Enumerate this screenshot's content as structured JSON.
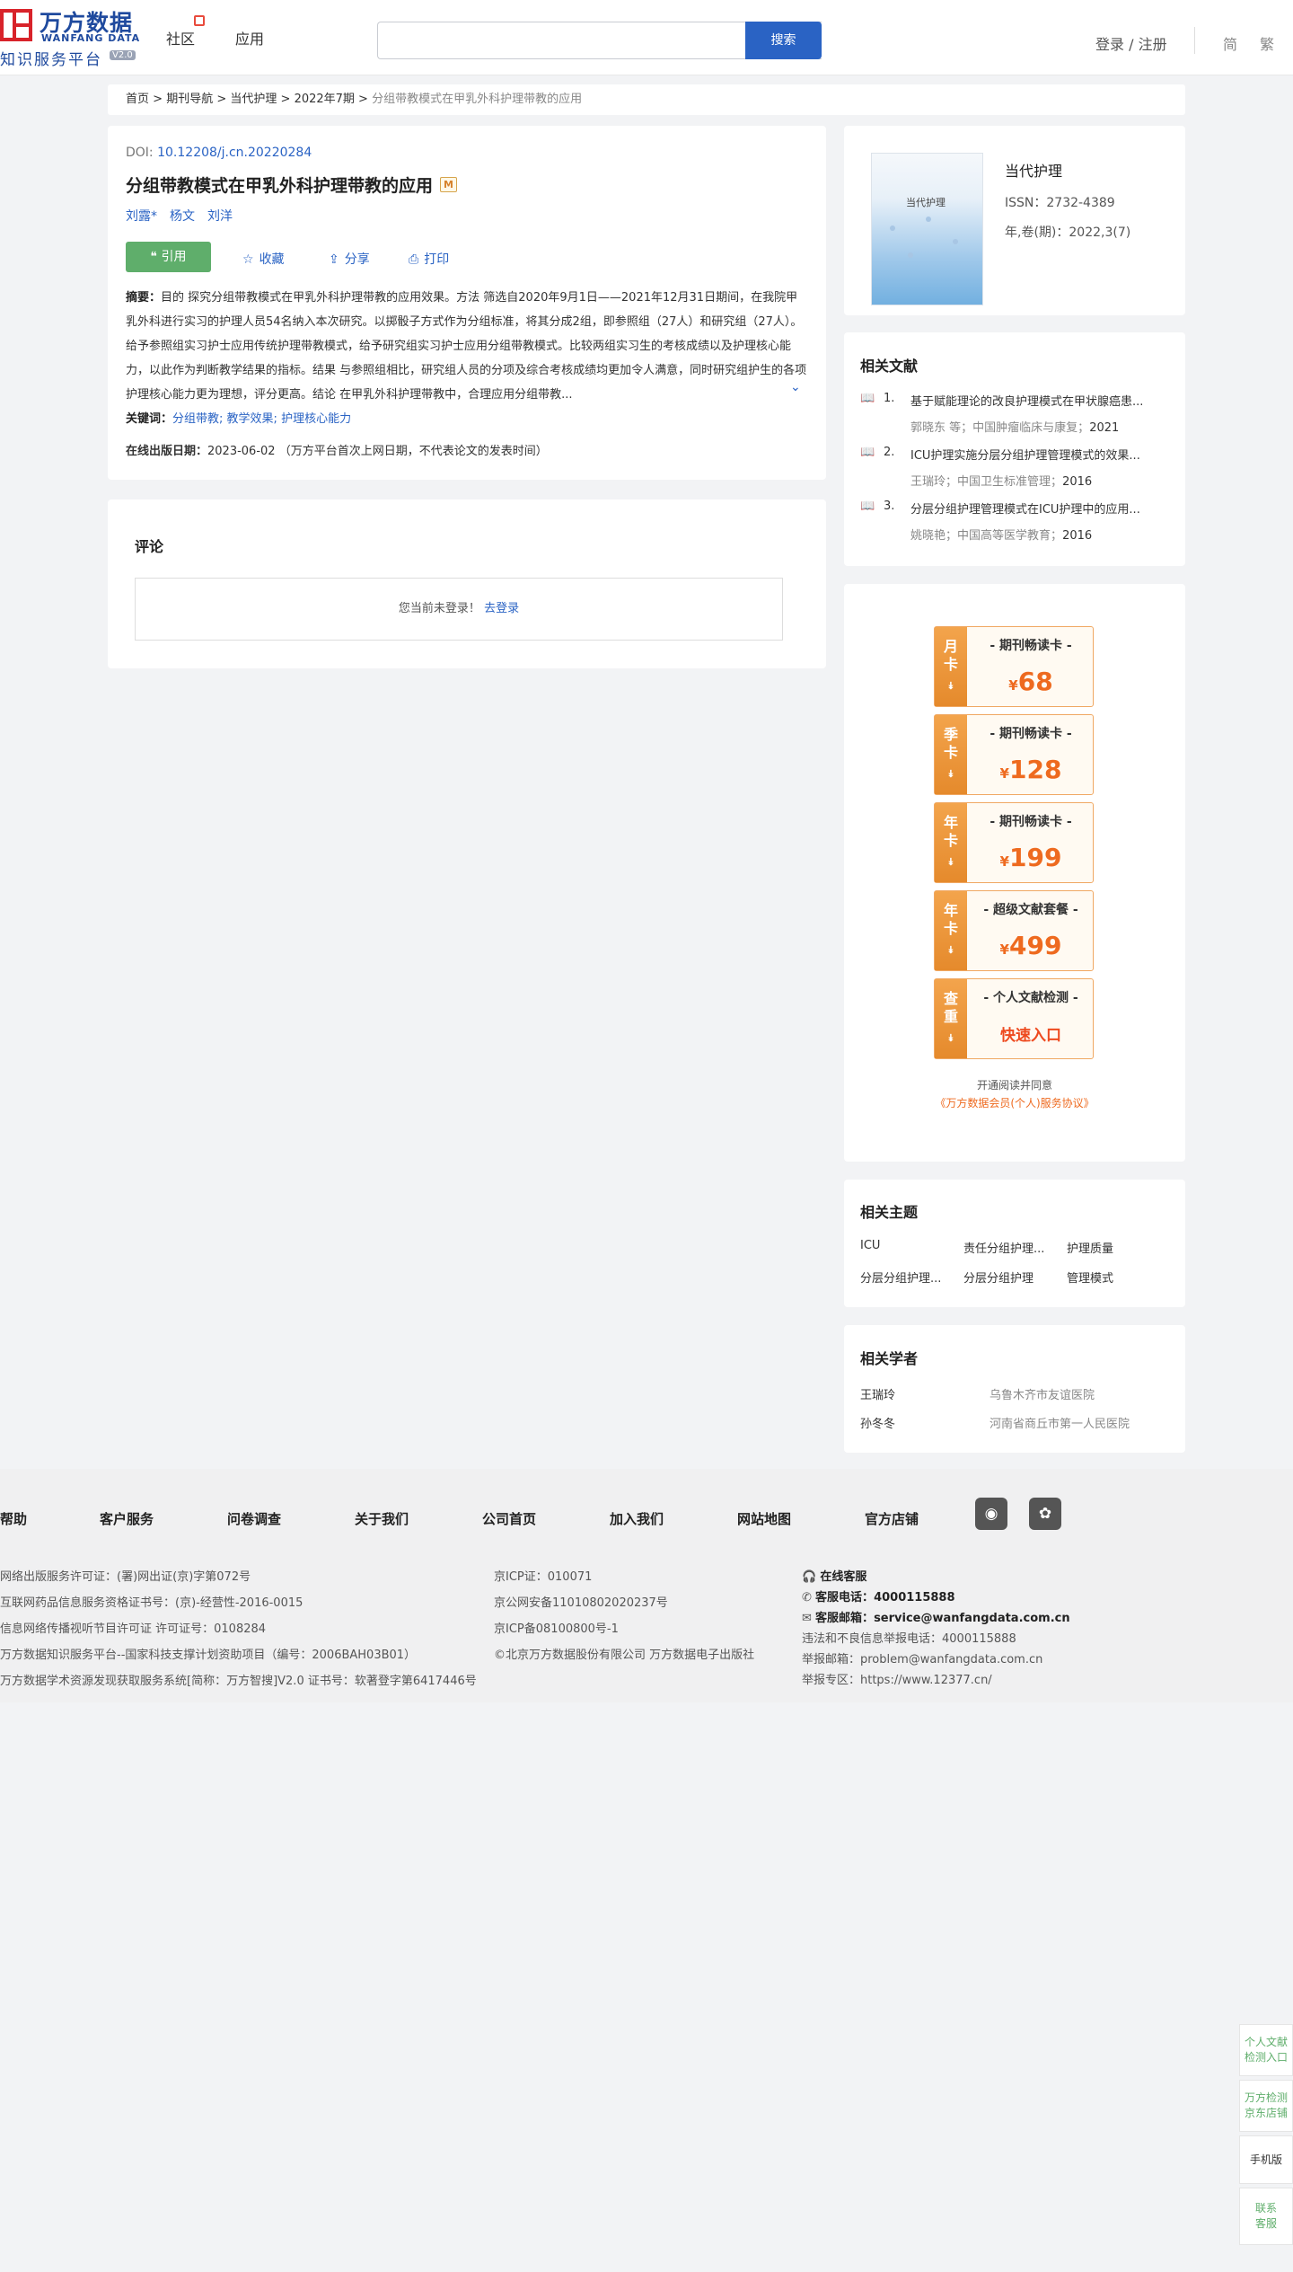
{
  "header": {
    "logo_cn": "万方数据",
    "logo_en": "WANFANG DATA",
    "logo_sub": "知识服务平台",
    "logo_ver": "V2.0",
    "nav": [
      "社区",
      "应用"
    ],
    "search_placeholder": "",
    "search_btn": "搜索",
    "login": "登录 / 注册",
    "lang_simplified": "简",
    "lang_traditional": "繁"
  },
  "breadcrumb": {
    "items": [
      "首页",
      "期刊导航",
      "当代护理",
      "2022年7期"
    ],
    "sep": " > ",
    "current": "分组带教模式在甲乳外科护理带教的应用"
  },
  "article": {
    "doi_label": "DOI:",
    "doi": "10.12208/j.cn.20220284",
    "title": "分组带教模式在甲乳外科护理带教的应用",
    "badge": "M",
    "authors": [
      "刘露*",
      "杨文",
      "刘洋"
    ],
    "actions": {
      "cite": "引用",
      "favorite": "收藏",
      "share": "分享",
      "print": "打印"
    },
    "abstract_label": "摘要：",
    "abstract": "目的 探究分组带教模式在甲乳外科护理带教的应用效果。方法 筛选自2020年9月1日——2021年12月31日期间，在我院甲乳外科进行实习的护理人员54名纳入本次研究。以掷骰子方式作为分组标准，将其分成2组，即参照组（27人）和研究组（27人）。给予参照组实习护士应用传统护理带教模式，给予研究组实习护士应用分组带教模式。比较两组实习生的考核成绩以及护理核心能力，以此作为判断教学结果的指标。结果 与参照组相比，研究组人员的分项及综合考核成绩均更加令人满意，同时研究组护生的各项护理核心能力更为理想，评分更高。结论 在甲乳外科护理带教中，合理应用分组带教...",
    "keywords_label": "关键词：",
    "keywords": [
      "分组带教;",
      "教学效果;",
      "护理核心能力"
    ],
    "pubdate_label": "在线出版日期：",
    "pubdate": "2023-06-02",
    "pubdate_note": "（万方平台首次上网日期，不代表论文的发表时间）"
  },
  "comment": {
    "title": "评论",
    "prompt": "您当前未登录！",
    "login_link": "去登录"
  },
  "journal": {
    "cover_title": "当代护理",
    "name": "当代护理",
    "issn": "ISSN：2732-4389",
    "volume": "年,卷(期)：2022,3(7)"
  },
  "related_docs": {
    "title": "相关文献",
    "items": [
      {
        "no": "1.",
        "title": "基于赋能理论的改良护理模式在甲状腺癌患...",
        "authors": "郭晓东  等",
        "journal": "中国肿瘤临床与康复",
        "year": "2021"
      },
      {
        "no": "2.",
        "title": "ICU护理实施分层分组护理管理模式的效果...",
        "authors": "王瑞玲",
        "journal": "中国卫生标准管理",
        "year": "2016"
      },
      {
        "no": "3.",
        "title": "分层分组护理管理模式在ICU护理中的应用...",
        "authors": "姚晓艳",
        "journal": "中国高等医学教育",
        "year": "2016"
      }
    ]
  },
  "promos": [
    {
      "side": [
        "月",
        "卡"
      ],
      "name": "- 期刊畅读卡 -",
      "currency": "¥",
      "price": "68"
    },
    {
      "side": [
        "季",
        "卡"
      ],
      "name": "- 期刊畅读卡 -",
      "currency": "¥",
      "price": "128"
    },
    {
      "side": [
        "年",
        "卡"
      ],
      "name": "- 期刊畅读卡 -",
      "currency": "¥",
      "price": "199"
    },
    {
      "side": [
        "年",
        "卡"
      ],
      "name": "- 超级文献套餐 -",
      "currency": "¥",
      "price": "499"
    },
    {
      "side": [
        "查",
        "重"
      ],
      "name": "- 个人文献检测 -",
      "quick": "快速入口"
    }
  ],
  "agree": {
    "line1": "开通阅读并同意",
    "line2": "《万方数据会员(个人)服务协议》"
  },
  "topics": {
    "title": "相关主题",
    "items": [
      "ICU",
      "责任分组护理...",
      "护理质量",
      "分层分组护理...",
      "分层分组护理",
      "管理模式"
    ]
  },
  "scholars": {
    "title": "相关学者",
    "items": [
      {
        "name": "王瑞玲",
        "org": "乌鲁木齐市友谊医院"
      },
      {
        "name": "孙冬冬",
        "org": "河南省商丘市第一人民医院"
      }
    ]
  },
  "footer": {
    "links": [
      "帮助",
      "客户服务",
      "问卷调查",
      "关于我们",
      "公司首页",
      "加入我们",
      "网站地图",
      "官方店铺"
    ],
    "col1": [
      "网络出版服务许可证：(署)网出证(京)字第072号",
      "互联网药品信息服务资格证书号：(京)-经营性-2016-0015",
      "信息网络传播视听节目许可证 许可证号：0108284",
      "万方数据知识服务平台--国家科技支撑计划资助项目（编号：2006BAH03B01）",
      "万方数据学术资源发现获取服务系统[简称：万方智搜]V2.0 证书号：软著登字第6417446号"
    ],
    "col2": [
      "京ICP证：010071",
      "京公网安备11010802020237号",
      "京ICP备08100800号-1",
      "©北京万方数据股份有限公司 万方数据电子出版社"
    ],
    "online_service": "在线客服",
    "phone_label": "客服电话：",
    "phone": "4000115888",
    "email_label": "客服邮箱：",
    "email": "service@wanfangdata.com.cn",
    "report_phone": "违法和不良信息举报电话：4000115888",
    "report_email": "举报邮箱：problem@wanfangdata.com.cn",
    "report_area": "举报专区：https://www.12377.cn/"
  },
  "float_bar": [
    "个人文献检测入口",
    "万方检测京东店铺",
    "手机版",
    "联系客服"
  ],
  "colors": {
    "brand_blue": "#2a63c4",
    "cite_green": "#5fae6b",
    "promo_orange": "#ee6a1f"
  }
}
